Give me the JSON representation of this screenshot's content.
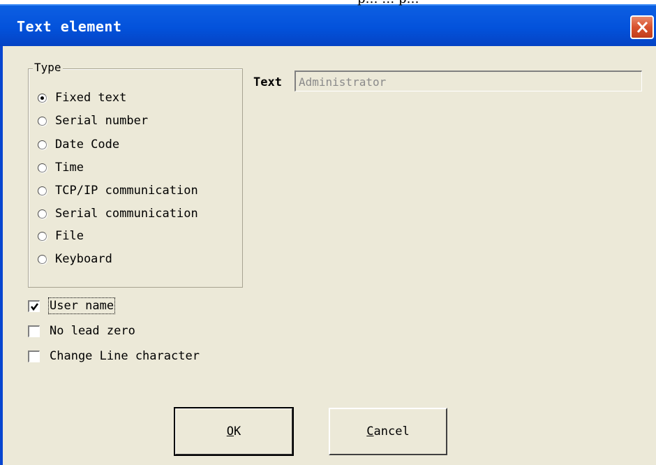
{
  "snippet_text": "p… … p…",
  "window": {
    "title": "Text element"
  },
  "type_group": {
    "label": "Type",
    "options": [
      {
        "label": "Fixed text",
        "selected": true
      },
      {
        "label": "Serial number",
        "selected": false
      },
      {
        "label": "Date Code",
        "selected": false
      },
      {
        "label": "Time",
        "selected": false
      },
      {
        "label": "TCP/IP communication",
        "selected": false
      },
      {
        "label": "Serial communication",
        "selected": false
      },
      {
        "label": "File",
        "selected": false
      },
      {
        "label": "Keyboard",
        "selected": false
      }
    ]
  },
  "text_field": {
    "label": "Text",
    "value": "Administrator"
  },
  "checkboxes": [
    {
      "label": "User name",
      "checked": true
    },
    {
      "label": "No lead zero",
      "checked": false
    },
    {
      "label": "Change Line character",
      "checked": false
    }
  ],
  "buttons": {
    "ok": {
      "mnemonic": "O",
      "rest": "K"
    },
    "cancel": {
      "mnemonic": "C",
      "rest": "ancel"
    }
  },
  "colors": {
    "title_bar": "#0a5ae0",
    "close_button": "#d8512e",
    "dialog_bg": "#ece9d8"
  }
}
